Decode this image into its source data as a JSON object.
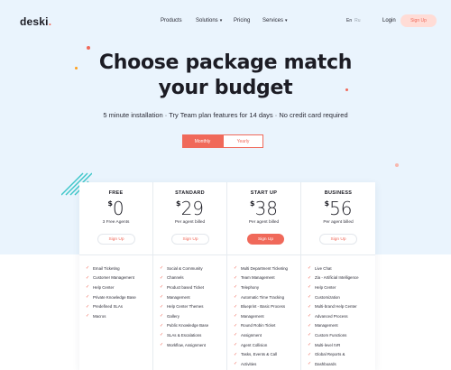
{
  "brand": {
    "name": "deski",
    "dot": "."
  },
  "nav": {
    "products": "Products",
    "solutions": "Solutions",
    "pricing": "Pricing",
    "services": "Services",
    "caret": "▾",
    "lang_active": "En",
    "lang_inactive": "Ru",
    "login": "Login",
    "signup": "Sign Up"
  },
  "hero": {
    "title_line1": "Choose package match",
    "title_line2": "your budget",
    "subtitle": "5 minute installation · Try Team plan features for 14 days · No credit card required"
  },
  "billing_toggle": {
    "monthly": "Monthly",
    "yearly": "Yearly",
    "selected": "Monthly"
  },
  "currency_symbol": "$",
  "check_glyph": "✓",
  "plans": [
    {
      "name": "FREE",
      "price": "0",
      "description": "3 Free Agents",
      "button": "Sign Up",
      "features": [
        "Email Ticketing",
        "Customer Management",
        "Help Center",
        "Private Knowledge Base",
        "Predefined SLAs",
        "Macros"
      ]
    },
    {
      "name": "STANDARD",
      "price": "29",
      "description": "Per agent billed",
      "button": "Sign Up",
      "features": [
        "Social & Community",
        "Channels",
        "Product based Ticket",
        "Management",
        "Help Center Themes",
        "Gallery",
        "Public Knowledge Base",
        "SLAs & Escalations",
        "Workflow, Assignment"
      ]
    },
    {
      "name": "START UP",
      "price": "38",
      "description": "Per agent billed",
      "button": "Sign Up",
      "features": [
        "Multi Department Ticketing",
        "Team Management",
        "Telephony",
        "Automatic Time Tracking",
        "Blueprint - Basic Process",
        "Management",
        "Round Robin Ticket",
        "Assignment",
        "Agent Collision",
        "Tasks, Events & Call",
        "Activities"
      ]
    },
    {
      "name": "BUSINESS",
      "price": "56",
      "description": "Per agent billed",
      "button": "Sign Up",
      "features": [
        "Live Chat",
        "Zia - Artificial Intelligence",
        "Help Center",
        "Customization",
        "Multi-brand Help Center",
        "Advanced Process",
        "Management",
        "Custom Functions",
        "Multi-level IVR",
        "Global Reports &",
        "Dashboards"
      ]
    }
  ],
  "colors": {
    "accent": "#f0695a",
    "hero_bg": "#eaf4fd",
    "stripes": "#3cc6c9"
  }
}
